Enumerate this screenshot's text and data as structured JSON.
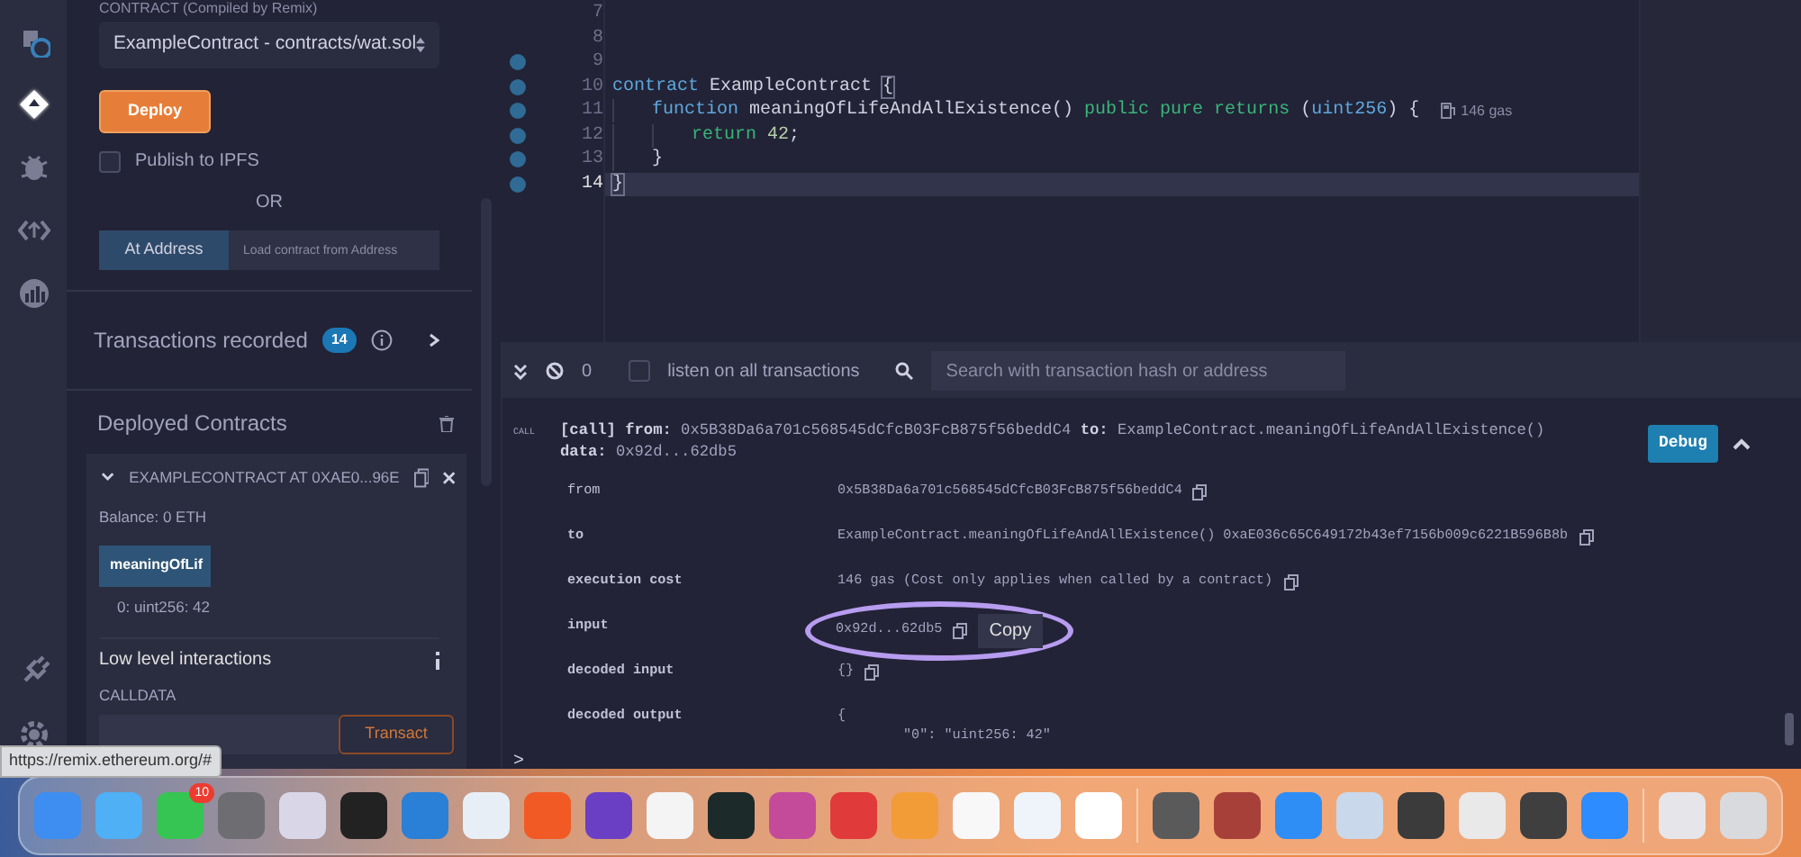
{
  "icon_bar": {
    "items": [
      {
        "kind": "files",
        "selected": false
      },
      {
        "kind": "deploy",
        "selected": true
      },
      {
        "kind": "debug",
        "selected": false
      },
      {
        "kind": "code",
        "selected": false
      },
      {
        "kind": "analysis",
        "selected": false
      }
    ],
    "bottom_items": [
      {
        "kind": "plugin",
        "selected": false
      },
      {
        "kind": "settings",
        "selected": false
      }
    ]
  },
  "side_panel": {
    "contract_label": "CONTRACT (Compiled by Remix)",
    "contract_select": "ExampleContract - contracts/wat.sol",
    "deploy_button": "Deploy",
    "publish_checkbox": {
      "label": "Publish to IPFS",
      "checked": false
    },
    "or_text": "OR",
    "at_address_button": "At Address",
    "at_address_placeholder": "Load contract from Address",
    "transactions": {
      "label": "Transactions recorded",
      "count": "14"
    },
    "deployed": {
      "title": "Deployed Contracts",
      "instance": {
        "title": "EXAMPLECONTRACT AT 0XAE0...96E",
        "expanded": true,
        "balance": "Balance: 0 ETH",
        "function_button": "meaningOfLif",
        "output": "0: uint256: 42",
        "low_level_title": "Low level interactions",
        "calldata_label": "CALLDATA",
        "transact_button": "Transact"
      }
    }
  },
  "editor": {
    "lines": [
      {
        "number": "7",
        "breakpoint": false,
        "current": false
      },
      {
        "number": "8",
        "breakpoint": false,
        "current": false
      },
      {
        "number": "9",
        "breakpoint": true,
        "current": false
      },
      {
        "number": "10",
        "breakpoint": true,
        "current": false,
        "segments": [
          {
            "text": "contract",
            "kind": "keyword"
          },
          {
            "text": " ExampleContract ",
            "kind": "plain"
          },
          {
            "text": "{",
            "kind": "bracket"
          }
        ],
        "children": [
          {
            "number": "11",
            "breakpoint": true,
            "current": false,
            "segments": [
              {
                "text": "function",
                "kind": "keyword"
              },
              {
                "text": " meaningOfLifeAndAllExistence() ",
                "kind": "plain"
              },
              {
                "text": "public pure returns",
                "kind": "modifier"
              },
              {
                "text": " (",
                "kind": "plain"
              },
              {
                "text": "uint256",
                "kind": "keyword"
              },
              {
                "text": ") {",
                "kind": "plain"
              }
            ],
            "hint": "146 gas",
            "children": [
              {
                "number": "12",
                "breakpoint": true,
                "current": false,
                "segments": [
                  {
                    "text": "return ",
                    "kind": "modifier"
                  },
                  {
                    "text": "42",
                    "kind": "number"
                  },
                  {
                    "text": ";",
                    "kind": "plain"
                  }
                ]
              }
            ]
          },
          {
            "number": "13",
            "breakpoint": true,
            "current": false,
            "segments": [
              {
                "text": "}",
                "kind": "plain"
              }
            ]
          }
        ]
      },
      {
        "number": "14",
        "breakpoint": true,
        "current": true,
        "segments": [
          {
            "text": "}",
            "kind": "bracket"
          }
        ]
      }
    ]
  },
  "terminal": {
    "toolbar": {
      "count": "0",
      "listen": {
        "label": "listen on all transactions",
        "checked": false
      },
      "search_placeholder": "Search with transaction hash or address"
    },
    "log": {
      "tag": "CALL",
      "summary": "**[call]  from:** 0x5B38Da6a701c568545dCfcB03FcB875f56beddC4 **to:** ExampleContract.meaningOfLifeAndAllExistence()",
      "summary_2": "**data:** 0x92d...62db5",
      "debug_button": "Debug",
      "expanded": true,
      "details": [
        {
          "label": "from",
          "lines": [
            "0x5B38Da6a701c568545dCfcB03FcB875f56beddC4"
          ],
          "copy": true,
          "highlighted": false
        },
        {
          "label": "to",
          "lines": [
            "ExampleContract.meaningOfLifeAndAllExistence() 0xaE036c65C649172b43ef7156b009c6221B596B8b"
          ],
          "copy": true,
          "highlighted": false
        },
        {
          "label": "execution cost",
          "lines": [
            "146 gas (Cost only applies when called by a contract)"
          ],
          "copy": true,
          "highlighted": false
        },
        {
          "label": "input",
          "lines": [
            "0x92d...62db5"
          ],
          "copy": true,
          "highlighted": true,
          "tooltip": "Copy"
        },
        {
          "label": "decoded input",
          "lines": [
            "{}"
          ],
          "copy": true,
          "highlighted": false
        },
        {
          "label": "decoded output",
          "lines": [
            "{",
            "        \"0\": \"uint256: 42\""
          ],
          "copy": false,
          "highlighted": false
        }
      ]
    },
    "prompt": ">"
  },
  "status_url": "https://remix.ethereum.org/#",
  "dock": {
    "groups": [
      [
        {
          "color": "#3d8ef0"
        },
        {
          "color": "#4fb0f5"
        },
        {
          "color": "#36c453",
          "badge": "10"
        },
        {
          "color": "#6d6d72"
        },
        {
          "color": "#d9d6e8"
        },
        {
          "color": "#222222"
        },
        {
          "color": "#2a7fd6"
        },
        {
          "color": "#e8eef5"
        },
        {
          "color": "#f15a24"
        },
        {
          "color": "#6a3fc4"
        },
        {
          "color": "#f4f4f4"
        },
        {
          "color": "#1d2a2a"
        },
        {
          "color": "#c44a9a"
        },
        {
          "color": "#e03a3a"
        },
        {
          "color": "#f29c38"
        },
        {
          "color": "#f8f8f8"
        },
        {
          "color": "#eef4fa"
        },
        {
          "color": "#ffffff"
        }
      ],
      [
        {
          "color": "#5a5a5a"
        },
        {
          "color": "#a8403a"
        },
        {
          "color": "#2f8ef5"
        },
        {
          "color": "#c9d8ea"
        },
        {
          "color": "#3b3b3b"
        },
        {
          "color": "#e9e9e9"
        },
        {
          "color": "#3f3f3f"
        },
        {
          "color": "#2d8cff"
        }
      ],
      [
        {
          "color": "#e6e6ea"
        },
        {
          "color": "#d8dade"
        }
      ]
    ]
  }
}
